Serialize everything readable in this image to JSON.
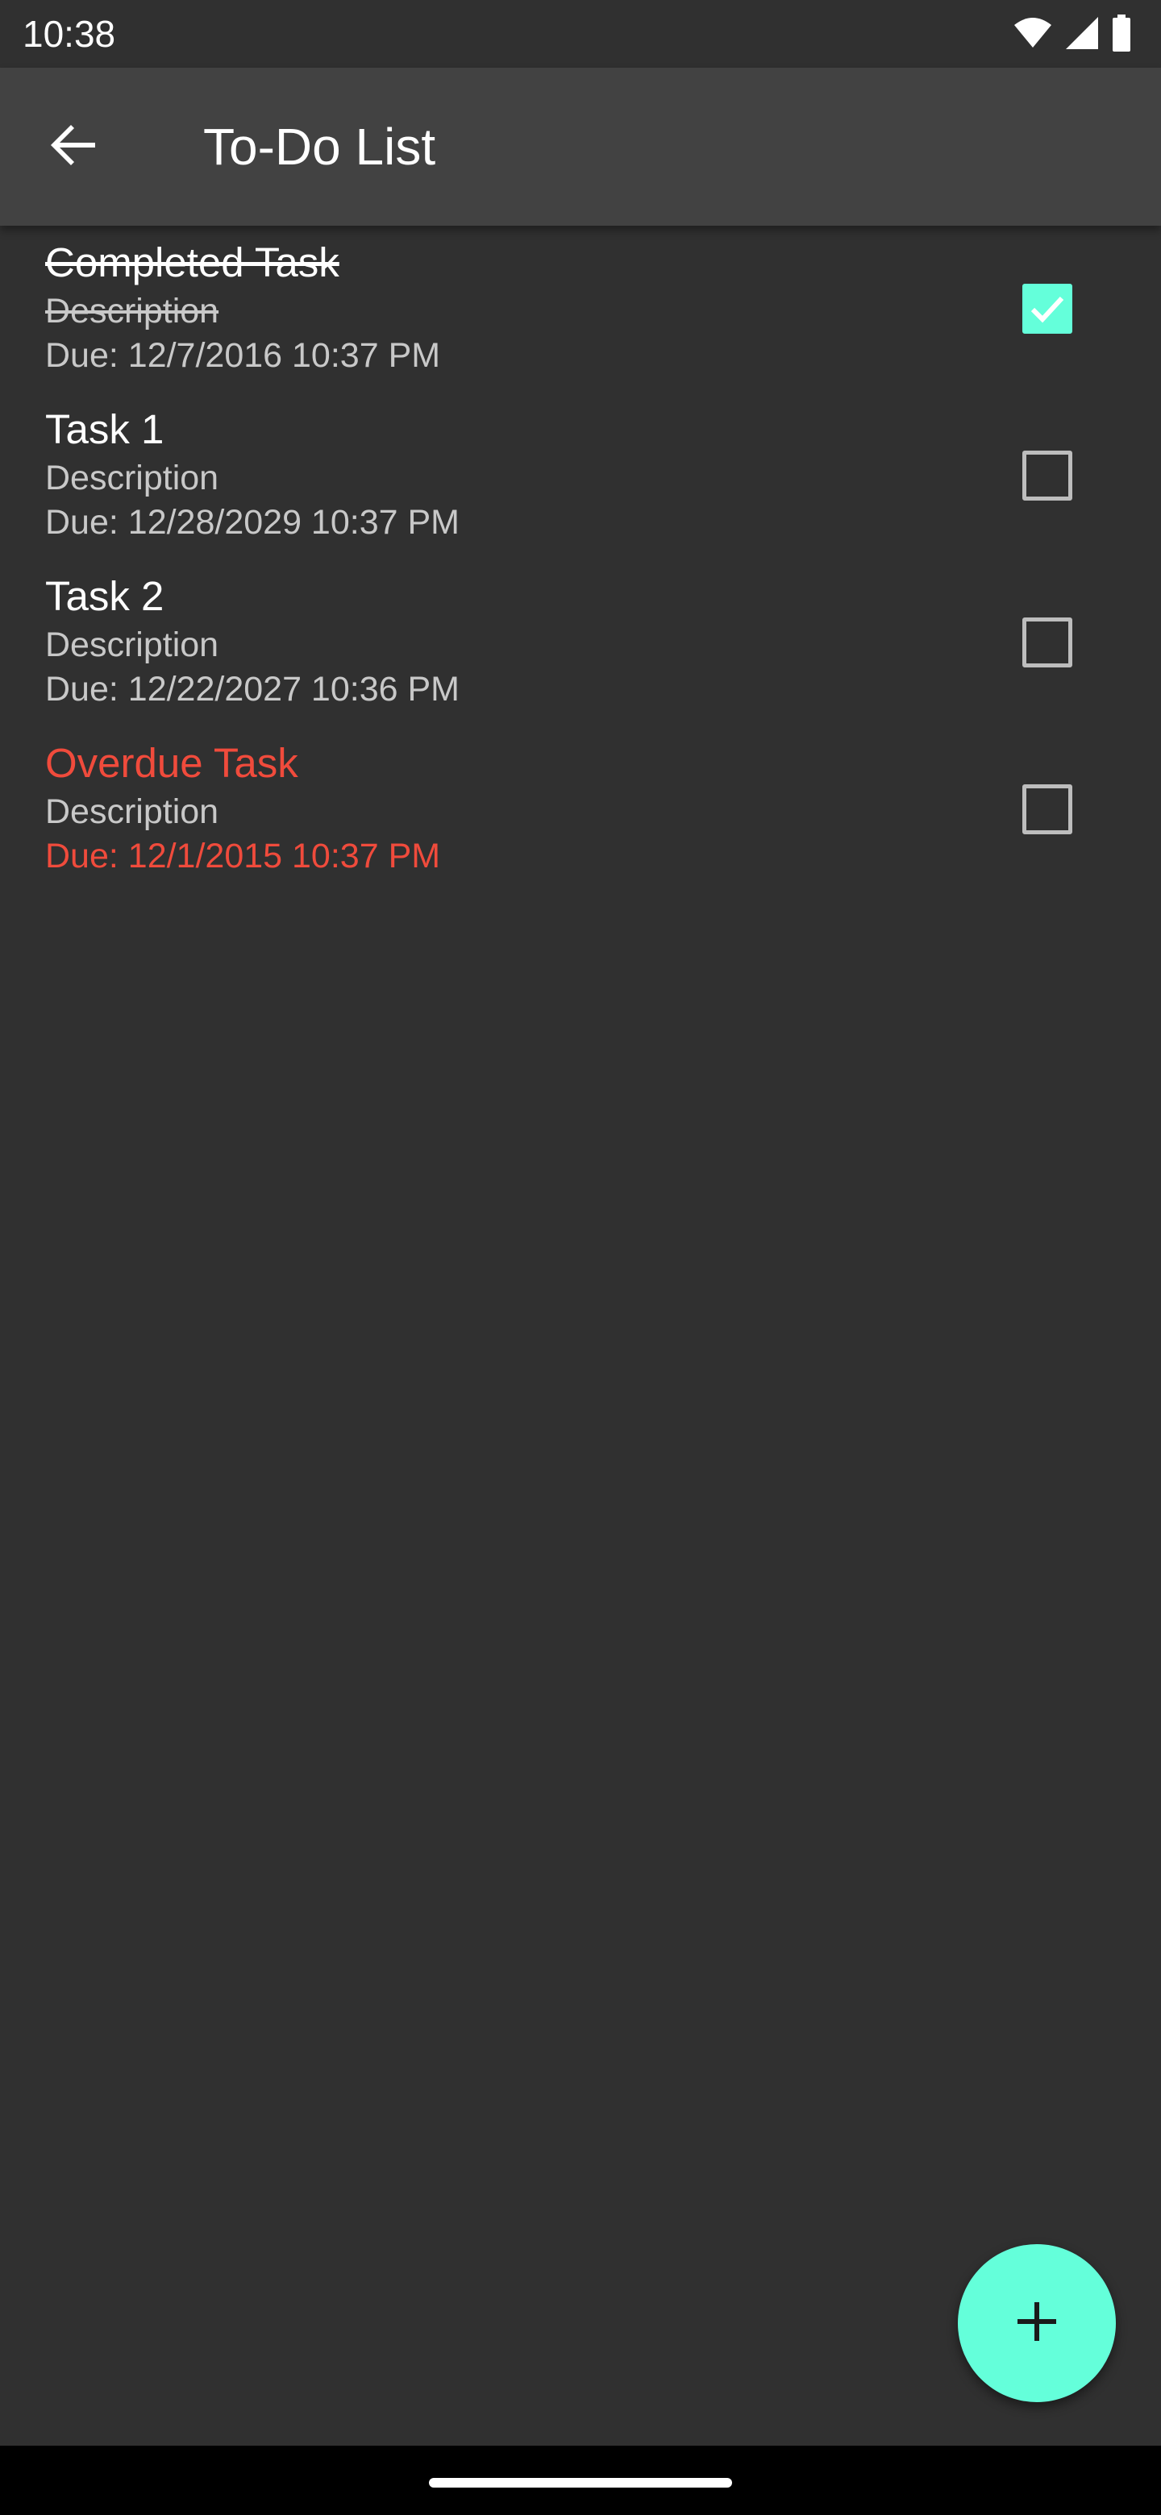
{
  "status_bar": {
    "time": "10:38",
    "icons": [
      "wifi-icon",
      "signal-icon",
      "battery-icon"
    ]
  },
  "app_bar": {
    "title": "To-Do List",
    "back_icon": "arrow-back-icon"
  },
  "tasks": [
    {
      "title": "Completed Task",
      "description": "Description",
      "due": "Due: 12/7/2016 10:37 PM",
      "checked": true,
      "state": "completed"
    },
    {
      "title": "Task 1",
      "description": "Description",
      "due": "Due: 12/28/2029 10:37 PM",
      "checked": false,
      "state": "normal"
    },
    {
      "title": "Task 2",
      "description": "Description",
      "due": "Due: 12/22/2027 10:36 PM",
      "checked": false,
      "state": "normal"
    },
    {
      "title": "Overdue Task",
      "description": "Description",
      "due": "Due: 12/1/2015 10:37 PM",
      "checked": false,
      "state": "overdue"
    }
  ],
  "fab": {
    "icon": "plus-icon"
  },
  "colors": {
    "background": "#303030",
    "app_bar": "#424242",
    "accent": "#64ffda",
    "overdue": "#f04b3c",
    "secondary_text": "#c8c8c8"
  }
}
